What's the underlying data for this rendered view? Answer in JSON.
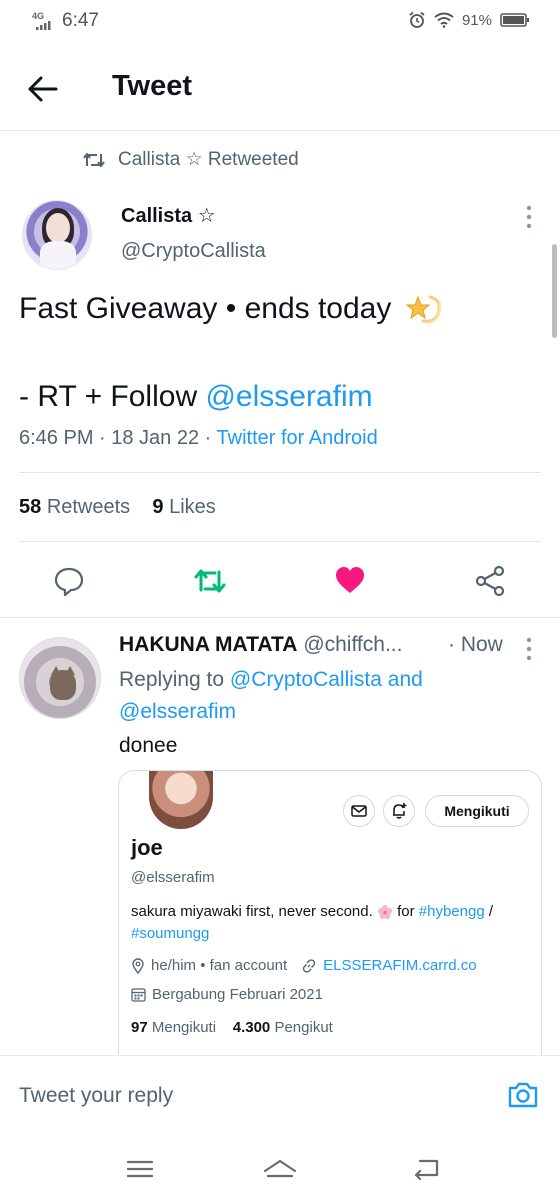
{
  "status_bar": {
    "network": "4G",
    "time": "6:47",
    "battery": "91%"
  },
  "app_bar": {
    "title": "Tweet"
  },
  "retweet_context": {
    "text": "Callista ☆ Retweeted"
  },
  "tweet": {
    "author_name": "Callista ☆",
    "author_handle": "@CryptoCallista",
    "text_line1": "Fast Giveaway • ends today",
    "text_line2_prefix": "- RT + Follow ",
    "text_line2_mention": "@elsserafim",
    "timestamp": "6:46 PM · 18 Jan 22 · ",
    "source": "Twitter for Android",
    "retweet_count": "58",
    "retweet_label": "Retweets",
    "like_count": "9",
    "like_label": "Likes",
    "liked": true,
    "retweeted": true
  },
  "reply": {
    "author_name": "HAKUNA MATATA",
    "author_handle": "@chiffch...",
    "time": "· Now",
    "replying_prefix": "Replying to ",
    "replying_user1": "@CryptoCallista",
    "replying_and": " and",
    "replying_user2": "@elsserafim",
    "text": "donee"
  },
  "profile_card": {
    "name": "joe",
    "handle": "@elsserafim",
    "follow_label": "Mengikuti",
    "bio_prefix": "sakura miyawaki first, never second.",
    "bio_for": " for ",
    "bio_tag1": "#hybengg",
    "bio_slash": " /",
    "bio_tag2": "#soumungg",
    "location": "he/him • fan account",
    "website": "ELSSERAFIM.carrd.co",
    "joined": "Bergabung Februari 2021",
    "following_count": "97",
    "following_label": "Mengikuti",
    "followers_count": "4.300",
    "followers_label": "Pengikut"
  },
  "reply_bar": {
    "placeholder": "Tweet your reply"
  },
  "colors": {
    "accent": "#1d9bf0",
    "retweet_green": "#00ba7c",
    "like_pink": "#f91880",
    "secondary_text": "#536471"
  }
}
